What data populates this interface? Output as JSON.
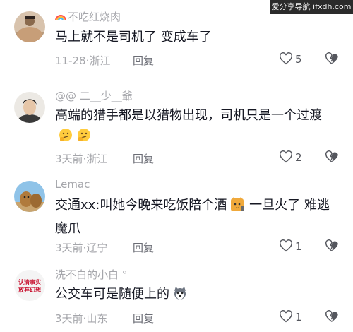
{
  "watermark": "爱分享导航 ifxdh.com",
  "comments": [
    {
      "name": "不吃红烧肉",
      "text": "马上就不是司机了 变成车了",
      "time": "11-28",
      "location": "浙江",
      "reply": "回复",
      "likes": "5"
    },
    {
      "name": "@@ 二__少__爺",
      "text": "高端的猎手都是以猎物出现，司机只是一个过渡",
      "time": "3天前",
      "location": "浙江",
      "reply": "回复",
      "likes": "2"
    },
    {
      "name": "Lemac",
      "text": "交通xx:叫她今晚来吃饭陪个酒",
      "text2": " 一旦火了 难逃魔爪",
      "time": "3天前",
      "location": "辽宁",
      "reply": "回复",
      "likes": "1"
    },
    {
      "name": "洗不白的小白 °",
      "avatar_text": "认清事实放弃幻想",
      "text": "公交车可是随便上的",
      "time": "3天前",
      "location": "山东",
      "reply": "回复",
      "likes": "1"
    }
  ],
  "meta_separator": "·"
}
